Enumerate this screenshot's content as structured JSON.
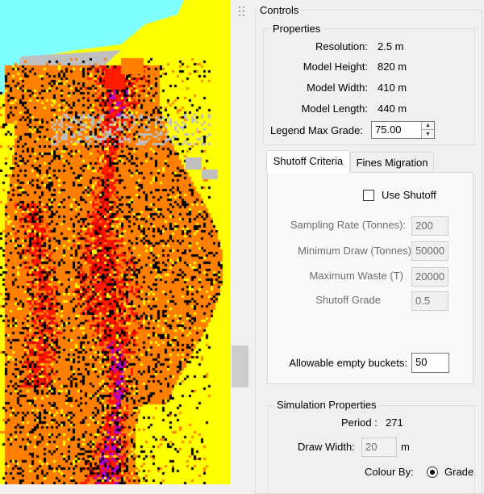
{
  "controls": {
    "title": "Controls"
  },
  "properties": {
    "title": "Properties",
    "resolution": {
      "label": "Resolution:",
      "value": "2.5 m"
    },
    "model_height": {
      "label": "Model Height:",
      "value": "820 m"
    },
    "model_width": {
      "label": "Model Width:",
      "value": "410 m"
    },
    "model_length": {
      "label": "Model Length:",
      "value": "440 m"
    },
    "legend_max_grade": {
      "label": "Legend Max Grade:",
      "value": "75.00"
    }
  },
  "tabs": [
    {
      "label": "Shutoff Criteria",
      "active": true
    },
    {
      "label": "Fines Migration",
      "active": false
    }
  ],
  "shutoff": {
    "use_shutoff": {
      "label": "Use Shutoff",
      "checked": false
    },
    "sampling_rate": {
      "label": "Sampling Rate (Tonnes):",
      "value": "200"
    },
    "minimum_draw": {
      "label": "Minimum Draw (Tonnes)",
      "value": "50000"
    },
    "maximum_waste": {
      "label": "Maximum Waste (T)",
      "value": "20000"
    },
    "shutoff_grade": {
      "label": "Shutoff Grade",
      "value": "0.5"
    },
    "allowable_empty_buckets": {
      "label": "Allowable empty buckets:",
      "value": "50"
    }
  },
  "simulation": {
    "title": "Simulation Properties",
    "period": {
      "label": "Period :",
      "value": "271"
    },
    "draw_width": {
      "label": "Draw Width:",
      "value": "20",
      "unit": "m"
    },
    "colour_by": {
      "label": "Colour By:",
      "option": "Grade",
      "selected": true
    }
  },
  "viz_colors": {
    "cyan": "#7fffff",
    "yellow": "#ffff00",
    "orange": "#ff8000",
    "red": "#ff1a00",
    "darkred": "#d40000",
    "magenta": "#b000d0",
    "gray": "#bfbfbf",
    "black": "#000000"
  }
}
